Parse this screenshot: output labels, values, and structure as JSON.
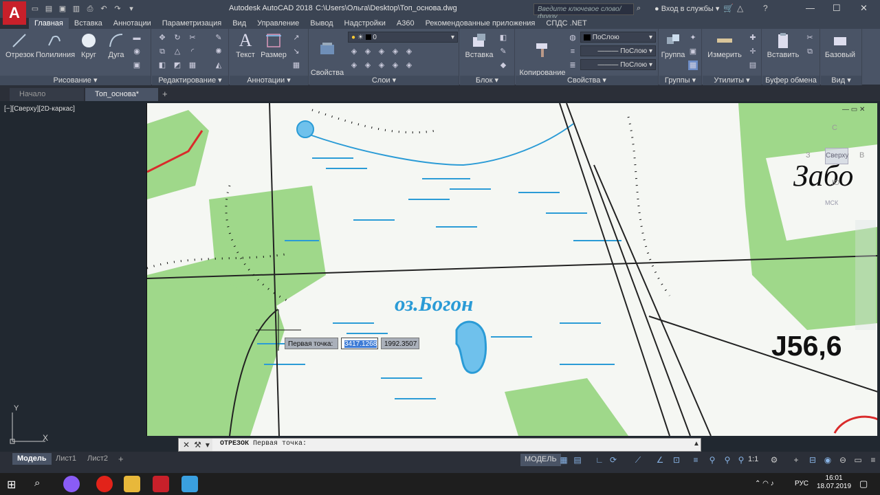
{
  "app": {
    "logo": "A",
    "name": "Autodesk AutoCAD 2018",
    "file": "C:\\Users\\Ольга\\Desktop\\Топ_основа.dwg",
    "search_placeholder": "Введите ключевое слово/фразу",
    "login": "Вход в службы"
  },
  "ribbon_tabs": [
    "Главная",
    "Вставка",
    "Аннотации",
    "Параметризация",
    "Вид",
    "Управление",
    "Вывод",
    "Надстройки",
    "А360",
    "Рекомендованные приложения",
    "СПДС .NET"
  ],
  "draw": {
    "line": "Отрезок",
    "polyline": "Полилиния",
    "circle": "Круг",
    "arc": "Дуга",
    "title": "Рисование"
  },
  "modify": {
    "title": "Редактирование"
  },
  "annot": {
    "text": "Текст",
    "dim": "Размер",
    "title": "Аннотации"
  },
  "layers": {
    "props": "Свойства\nслоя",
    "current": "0",
    "title": "Слои"
  },
  "block": {
    "insert": "Вставка",
    "title": "Блок"
  },
  "props": {
    "copy": "Копирование\nсвойства",
    "color": "ПоСлою",
    "linetype": "ПоСлою",
    "lineweight": "ПоСлою",
    "title": "Свойства"
  },
  "groups": {
    "group": "Группа",
    "title": "Группы"
  },
  "utils": {
    "measure": "Измерить",
    "title": "Утилиты"
  },
  "clipboard": {
    "paste": "Вставить",
    "title": "Буфер обмена"
  },
  "view": {
    "base": "Базовый",
    "title": "Вид"
  },
  "doc_tabs": {
    "start": "Начало",
    "current": "Топ_основа*",
    "add": "+"
  },
  "viewport": {
    "label": "[−][Сверху][2D-каркас]",
    "viewcube_top": "Сверху",
    "viewcube_n": "С",
    "viewcube_w": "З",
    "viewcube_e": "В",
    "viewcube_s": "Ю",
    "ucs": "МСК"
  },
  "map": {
    "lake_label": "оз.Богон",
    "elevation": "J56,6",
    "village": "Забо"
  },
  "dynamic_input": {
    "prompt": "Первая точка:",
    "x": "3417.1268",
    "y": "1992.3507"
  },
  "command": {
    "name": "ОТРЕЗОК",
    "prompt": "Первая точка:"
  },
  "ucs_axes": {
    "x": "X",
    "y": "Y"
  },
  "layout_tabs": [
    "Модель",
    "Лист1",
    "Лист2"
  ],
  "status": {
    "model": "МОДЕЛЬ",
    "scale": "1:1"
  },
  "system": {
    "lang": "РУС",
    "time": "16:01",
    "date": "18.07.2019"
  },
  "colors": {
    "ribbon": "#4a5466",
    "title": "#3b4453",
    "accent": "#c8202a",
    "map_water": "#2a9bd6",
    "map_forest": "#9fd88a"
  }
}
